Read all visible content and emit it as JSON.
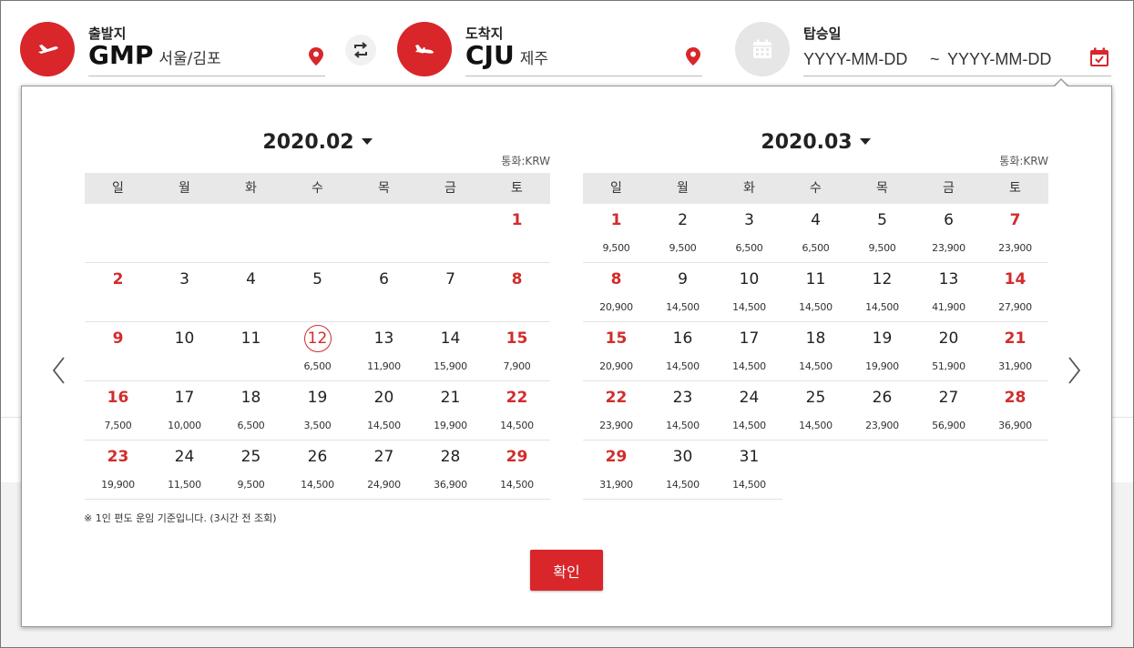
{
  "colors": {
    "accent": "#d8262b",
    "weekend": "#d22c2c",
    "header_bg": "#e8e8e8"
  },
  "departure": {
    "label": "출발지",
    "code": "GMP",
    "city": "서울/김포",
    "icon": "plane-takeoff-icon"
  },
  "swap": {
    "icon": "swap-arrows-icon"
  },
  "arrival": {
    "label": "도착지",
    "code": "CJU",
    "city": "제주",
    "icon": "plane-landing-icon"
  },
  "boarding": {
    "label": "탑승일",
    "start_placeholder": "YYYY-MM-DD",
    "separator": "~",
    "end_placeholder": "YYYY-MM-DD",
    "icon": "calendar-icon"
  },
  "calendars": [
    {
      "month": "2020.02",
      "currency": "통화:KRW",
      "weekdays": [
        "일",
        "월",
        "화",
        "수",
        "목",
        "금",
        "토"
      ],
      "first_weekday": 6,
      "days": 29,
      "selected": 12,
      "prices": {
        "12": "6,500",
        "13": "11,900",
        "14": "15,900",
        "15": "7,900",
        "16": "7,500",
        "17": "10,000",
        "18": "6,500",
        "19": "3,500",
        "20": "14,500",
        "21": "19,900",
        "22": "14,500",
        "23": "19,900",
        "24": "11,500",
        "25": "9,500",
        "26": "14,500",
        "27": "24,900",
        "28": "36,900",
        "29": "14,500"
      }
    },
    {
      "month": "2020.03",
      "currency": "통화:KRW",
      "weekdays": [
        "일",
        "월",
        "화",
        "수",
        "목",
        "금",
        "토"
      ],
      "first_weekday": 0,
      "days": 31,
      "selected": null,
      "prices": {
        "1": "9,500",
        "2": "9,500",
        "3": "6,500",
        "4": "6,500",
        "5": "9,500",
        "6": "23,900",
        "7": "23,900",
        "8": "20,900",
        "9": "14,500",
        "10": "14,500",
        "11": "14,500",
        "12": "14,500",
        "13": "41,900",
        "14": "27,900",
        "15": "20,900",
        "16": "14,500",
        "17": "14,500",
        "18": "14,500",
        "19": "19,900",
        "20": "51,900",
        "21": "31,900",
        "22": "23,900",
        "23": "14,500",
        "24": "14,500",
        "25": "14,500",
        "26": "23,900",
        "27": "56,900",
        "28": "36,900",
        "29": "31,900",
        "30": "14,500",
        "31": "14,500"
      }
    }
  ],
  "note": "※ 1인 편도 운임 기준입니다. (3시간 전 조회)",
  "confirm_label": "확인",
  "nav": {
    "prev_icon": "chevron-left-icon",
    "next_icon": "chevron-right-icon"
  }
}
